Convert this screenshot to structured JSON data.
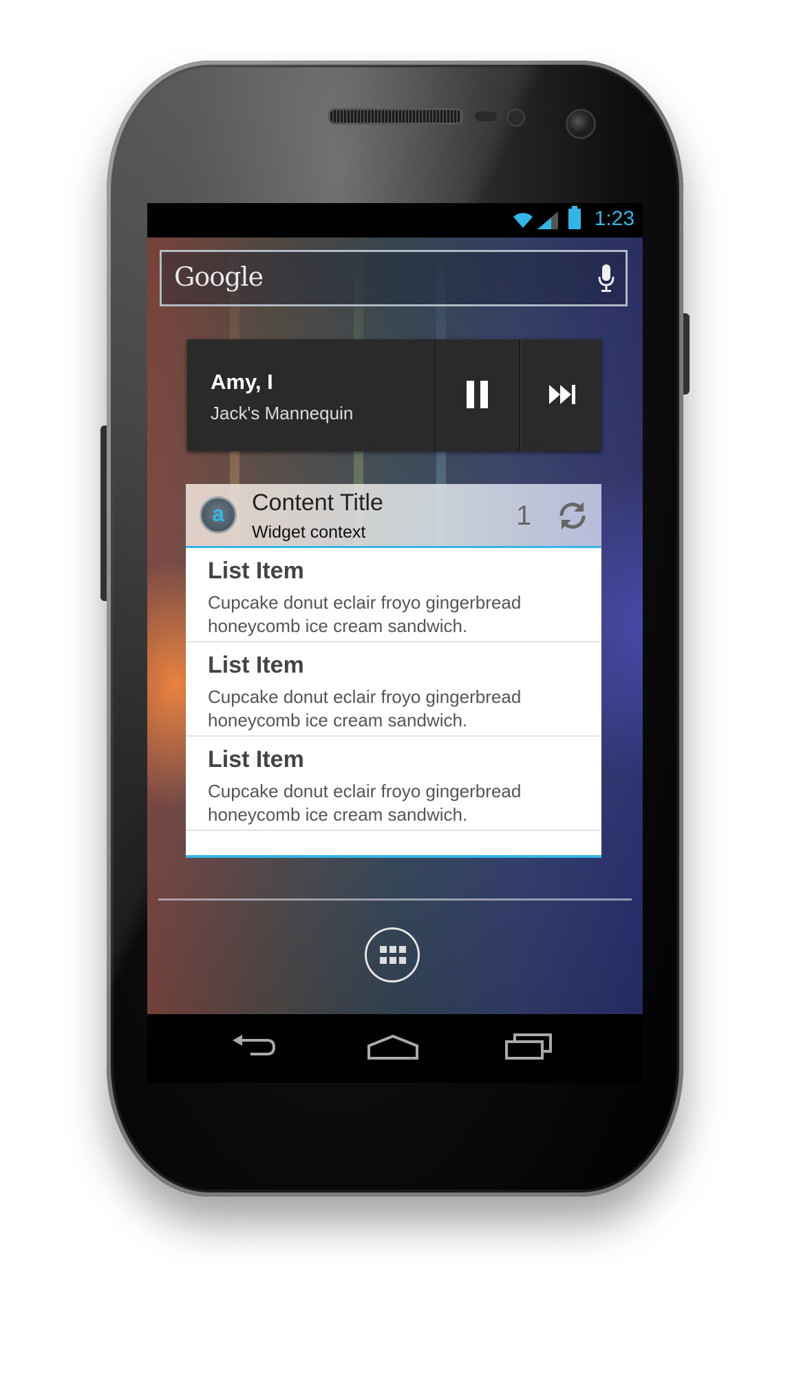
{
  "status_bar": {
    "time": "1:23",
    "icons": [
      "wifi-icon",
      "signal-icon",
      "battery-icon"
    ],
    "accent": "#33b5e5"
  },
  "search": {
    "logo": "Google",
    "mic_icon": "mic-icon"
  },
  "music_widget": {
    "title": "Amy, I",
    "artist": "Jack's Mannequin",
    "buttons": [
      "pause-icon",
      "skip-next-icon"
    ]
  },
  "content_widget": {
    "avatar_letter": "a",
    "title": "Content Title",
    "context": "Widget context",
    "count": "1",
    "refresh_icon": "refresh-icon",
    "items": [
      {
        "title": "List Item",
        "body": "Cupcake donut eclair froyo gingerbread honeycomb ice cream sandwich."
      },
      {
        "title": "List Item",
        "body": "Cupcake donut eclair froyo gingerbread honeycomb ice cream sandwich."
      },
      {
        "title": "List Item",
        "body": "Cupcake donut eclair froyo gingerbread honeycomb ice cream sandwich."
      }
    ]
  },
  "dock": {
    "apps_icon": "apps-grid-icon"
  },
  "nav": {
    "buttons": [
      "back-icon",
      "home-icon",
      "recent-apps-icon"
    ]
  }
}
